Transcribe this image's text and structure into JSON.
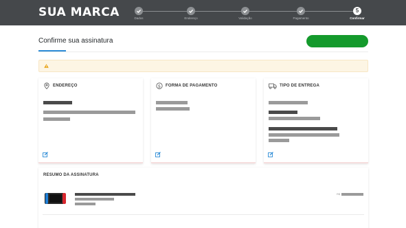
{
  "header": {
    "brand": "SUA MARCA",
    "steps": [
      {
        "label": "Dados",
        "state": "done"
      },
      {
        "label": "Endereço",
        "state": "done"
      },
      {
        "label": "Validação",
        "state": "done"
      },
      {
        "label": "Pagamento",
        "state": "done"
      },
      {
        "label": "Confirmar",
        "number": "5",
        "state": "active"
      }
    ]
  },
  "page": {
    "title": "Confirme sua assinatura"
  },
  "cards": {
    "address": {
      "title": "ENDEREÇO",
      "icon": "map-pin-icon"
    },
    "payment": {
      "title": "FORMA DE PAGAMENTO",
      "icon": "dollar-icon"
    },
    "delivery": {
      "title": "TIPO DE ENTREGA",
      "icon": "truck-icon"
    }
  },
  "summary": {
    "title": "RESUMO DA ASSINATURA",
    "price_prefix": "R$"
  },
  "colors": {
    "header_bg": "#45484b",
    "confirm_button": "#149a2c",
    "accent": "#2b8bd6",
    "warning_bg": "#fdf5e4",
    "warning_icon": "#e8a317"
  }
}
